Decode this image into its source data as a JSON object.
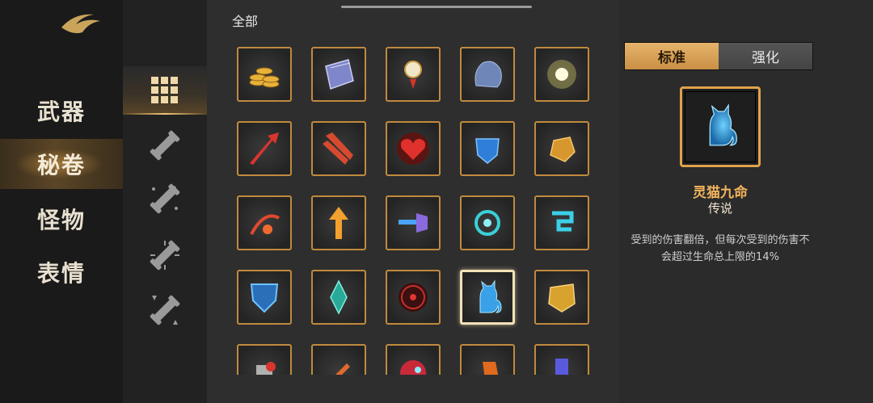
{
  "nav": {
    "items": [
      {
        "label": "武器",
        "active": false
      },
      {
        "label": "秘卷",
        "active": true
      },
      {
        "label": "怪物",
        "active": false
      },
      {
        "label": "表情",
        "active": false
      }
    ]
  },
  "filters": [
    {
      "icon": "grid-icon",
      "active": true
    },
    {
      "icon": "scroll-single-icon",
      "active": false
    },
    {
      "icon": "scroll-sparkle-icon",
      "active": false
    },
    {
      "icon": "scroll-burst-icon",
      "active": false
    },
    {
      "icon": "scroll-arrows-icon",
      "active": false
    }
  ],
  "grid": {
    "category_title": "全部",
    "selected_index": 18,
    "items": [
      "gold-coins-icon",
      "spellbook-icon",
      "amulet-icon",
      "stone-icon",
      "light-orb-icon",
      "red-arrow-icon",
      "triple-arrow-icon",
      "heart-icon",
      "blue-shield-icon",
      "golden-glove-icon",
      "fire-bow-icon",
      "up-arrow-icon",
      "piercing-arrow-icon",
      "blue-ring-icon",
      "blue-scroll-icon",
      "blue-armor-icon",
      "green-crystal-icon",
      "red-target-icon",
      "spirit-cat-icon",
      "gold-rune-icon",
      "row5-item-1-icon",
      "row5-item-2-icon",
      "row5-item-3-icon",
      "row5-item-4-icon",
      "row5-item-5-icon"
    ]
  },
  "detail": {
    "tabs": [
      "标准",
      "强化"
    ],
    "active_tab": 0,
    "icon": "spirit-cat-icon",
    "name": "灵猫九命",
    "rarity": "传说",
    "description": "受到的伤害翻倍，但每次受到的伤害不会超过生命总上限的14%"
  },
  "colors": {
    "frame_gold": "#c08a3e",
    "name_orange": "#f2b35c",
    "tab_active": "#e7b46b"
  }
}
